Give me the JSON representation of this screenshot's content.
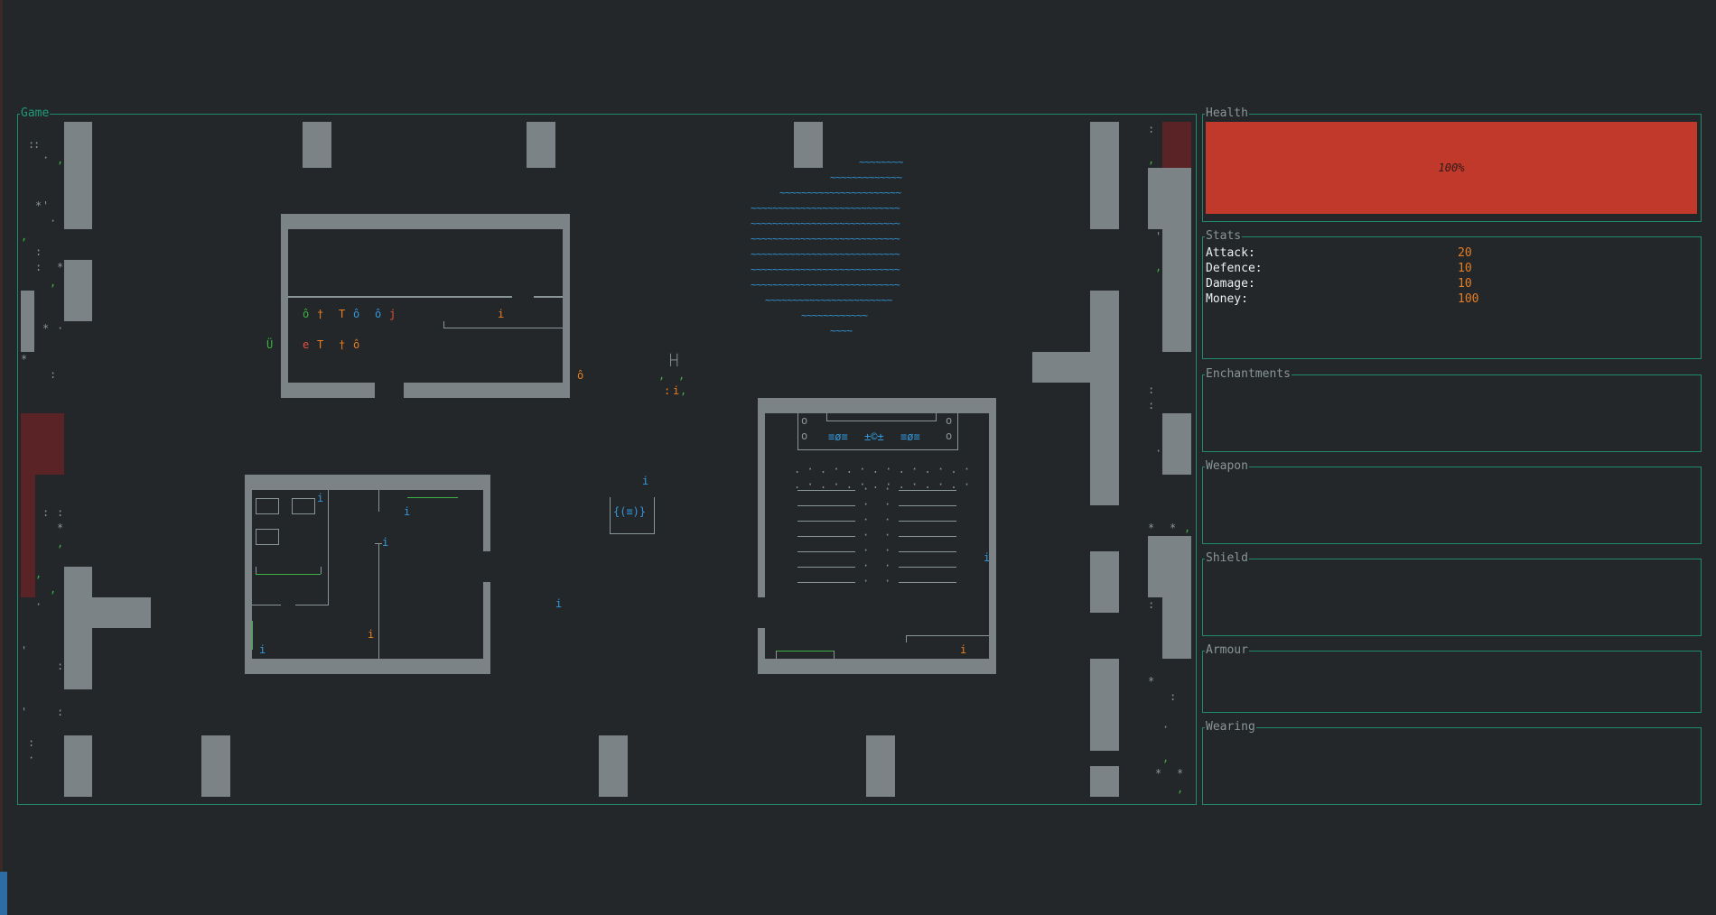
{
  "panels": {
    "game": "Game",
    "health": "Health",
    "stats": "Stats",
    "enchantments": "Enchantments",
    "weapon": "Weapon",
    "shield": "Shield",
    "armour": "Armour",
    "wearing": "Wearing"
  },
  "health": {
    "label": "100%",
    "fraction": 1.0,
    "color": "#c0392b"
  },
  "stats": [
    {
      "name": "Attack:",
      "value": "20"
    },
    {
      "name": "Defence:",
      "value": "10"
    },
    {
      "name": "Damage:",
      "value": "10"
    },
    {
      "name": "Money:",
      "value": "100"
    }
  ],
  "colors": {
    "background": "#232729",
    "border": "#1f8a6c",
    "wall": "#7b8386",
    "accent_orange": "#e67e22",
    "accent_green": "#3db143",
    "accent_blue": "#3498db"
  },
  "map": {
    "water_row": "~~~~~~~~~~~~~~~~~~~~~~~~~~~~~~~~~~~~",
    "shrine": "{(≡)}",
    "altar_left": "≡ø≡",
    "altar_mid": "±©±",
    "altar_right": "≡ø≡",
    "npc": "i",
    "item_o": "ô",
    "item_t": "T",
    "item_dagger": "†",
    "item_u": "Ü",
    "item_e": "e",
    "item_j": "j",
    "ground_colon": ":",
    "ground_dot": "·",
    "ground_comma": ",",
    "ground_star": "*",
    "ground_quote": "'",
    "player": "@",
    "pew": "o",
    "ladder": "├┤",
    "dots_row": ". · . · . · . · . · . · . ·"
  }
}
